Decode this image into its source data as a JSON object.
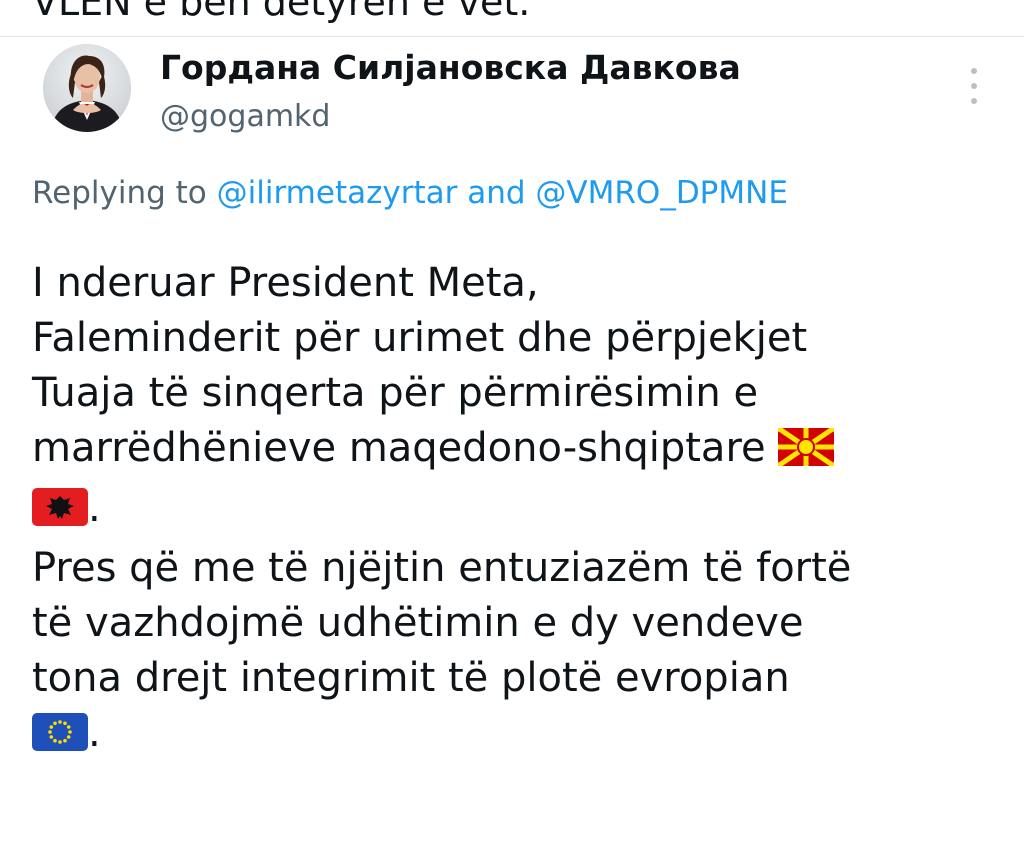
{
  "above_tweet": {
    "text": "VLEN e bën detyrën e vet."
  },
  "author": {
    "name": "Гордана Силјановска Давкова",
    "handle": "@gogamkd"
  },
  "menu": {
    "icon": "more-vertical-icon"
  },
  "reply": {
    "prefix": "Replying to",
    "mention1": "@ilirmetazyrtar",
    "joiner": "and",
    "mention2": "@VMRO_DPMNE"
  },
  "tweet": {
    "line1": "I nderuar President Meta,",
    "line2": "Faleminderit për urimet dhe përpjekjet",
    "line3": "Tuaja të sinqerta për përmirësimin e",
    "line4": "marrëdhënieve maqedono-shqiptare",
    "line5_end": ".",
    "line6": "Pres që me të njëjtin entuziazëm të fortë",
    "line7": "të vazhdojmë udhëtimin e dy vendeve",
    "line8": "tona drejt integrimit të plotë evropian",
    "line9_end": "."
  },
  "emoji": {
    "flag1": "north-macedonia-flag",
    "flag2": "albania-flag",
    "flag3": "eu-flag"
  },
  "colors": {
    "link": "#1d9bf0",
    "secondary_text": "#536471",
    "primary_text": "#0f1419"
  }
}
